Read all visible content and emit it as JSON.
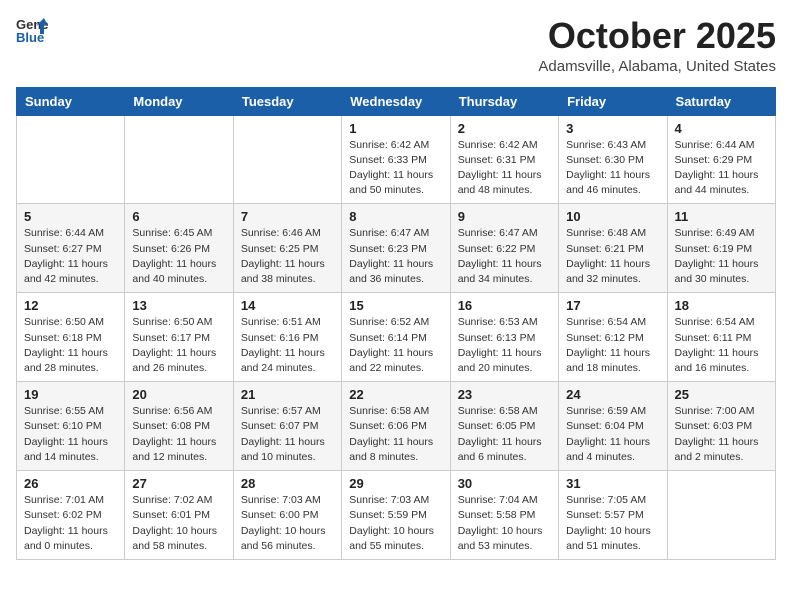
{
  "header": {
    "logo_general": "General",
    "logo_blue": "Blue",
    "month_title": "October 2025",
    "location": "Adamsville, Alabama, United States"
  },
  "days_of_week": [
    "Sunday",
    "Monday",
    "Tuesday",
    "Wednesday",
    "Thursday",
    "Friday",
    "Saturday"
  ],
  "weeks": [
    [
      {
        "day": "",
        "info": ""
      },
      {
        "day": "",
        "info": ""
      },
      {
        "day": "",
        "info": ""
      },
      {
        "day": "1",
        "info": "Sunrise: 6:42 AM\nSunset: 6:33 PM\nDaylight: 11 hours\nand 50 minutes."
      },
      {
        "day": "2",
        "info": "Sunrise: 6:42 AM\nSunset: 6:31 PM\nDaylight: 11 hours\nand 48 minutes."
      },
      {
        "day": "3",
        "info": "Sunrise: 6:43 AM\nSunset: 6:30 PM\nDaylight: 11 hours\nand 46 minutes."
      },
      {
        "day": "4",
        "info": "Sunrise: 6:44 AM\nSunset: 6:29 PM\nDaylight: 11 hours\nand 44 minutes."
      }
    ],
    [
      {
        "day": "5",
        "info": "Sunrise: 6:44 AM\nSunset: 6:27 PM\nDaylight: 11 hours\nand 42 minutes."
      },
      {
        "day": "6",
        "info": "Sunrise: 6:45 AM\nSunset: 6:26 PM\nDaylight: 11 hours\nand 40 minutes."
      },
      {
        "day": "7",
        "info": "Sunrise: 6:46 AM\nSunset: 6:25 PM\nDaylight: 11 hours\nand 38 minutes."
      },
      {
        "day": "8",
        "info": "Sunrise: 6:47 AM\nSunset: 6:23 PM\nDaylight: 11 hours\nand 36 minutes."
      },
      {
        "day": "9",
        "info": "Sunrise: 6:47 AM\nSunset: 6:22 PM\nDaylight: 11 hours\nand 34 minutes."
      },
      {
        "day": "10",
        "info": "Sunrise: 6:48 AM\nSunset: 6:21 PM\nDaylight: 11 hours\nand 32 minutes."
      },
      {
        "day": "11",
        "info": "Sunrise: 6:49 AM\nSunset: 6:19 PM\nDaylight: 11 hours\nand 30 minutes."
      }
    ],
    [
      {
        "day": "12",
        "info": "Sunrise: 6:50 AM\nSunset: 6:18 PM\nDaylight: 11 hours\nand 28 minutes."
      },
      {
        "day": "13",
        "info": "Sunrise: 6:50 AM\nSunset: 6:17 PM\nDaylight: 11 hours\nand 26 minutes."
      },
      {
        "day": "14",
        "info": "Sunrise: 6:51 AM\nSunset: 6:16 PM\nDaylight: 11 hours\nand 24 minutes."
      },
      {
        "day": "15",
        "info": "Sunrise: 6:52 AM\nSunset: 6:14 PM\nDaylight: 11 hours\nand 22 minutes."
      },
      {
        "day": "16",
        "info": "Sunrise: 6:53 AM\nSunset: 6:13 PM\nDaylight: 11 hours\nand 20 minutes."
      },
      {
        "day": "17",
        "info": "Sunrise: 6:54 AM\nSunset: 6:12 PM\nDaylight: 11 hours\nand 18 minutes."
      },
      {
        "day": "18",
        "info": "Sunrise: 6:54 AM\nSunset: 6:11 PM\nDaylight: 11 hours\nand 16 minutes."
      }
    ],
    [
      {
        "day": "19",
        "info": "Sunrise: 6:55 AM\nSunset: 6:10 PM\nDaylight: 11 hours\nand 14 minutes."
      },
      {
        "day": "20",
        "info": "Sunrise: 6:56 AM\nSunset: 6:08 PM\nDaylight: 11 hours\nand 12 minutes."
      },
      {
        "day": "21",
        "info": "Sunrise: 6:57 AM\nSunset: 6:07 PM\nDaylight: 11 hours\nand 10 minutes."
      },
      {
        "day": "22",
        "info": "Sunrise: 6:58 AM\nSunset: 6:06 PM\nDaylight: 11 hours\nand 8 minutes."
      },
      {
        "day": "23",
        "info": "Sunrise: 6:58 AM\nSunset: 6:05 PM\nDaylight: 11 hours\nand 6 minutes."
      },
      {
        "day": "24",
        "info": "Sunrise: 6:59 AM\nSunset: 6:04 PM\nDaylight: 11 hours\nand 4 minutes."
      },
      {
        "day": "25",
        "info": "Sunrise: 7:00 AM\nSunset: 6:03 PM\nDaylight: 11 hours\nand 2 minutes."
      }
    ],
    [
      {
        "day": "26",
        "info": "Sunrise: 7:01 AM\nSunset: 6:02 PM\nDaylight: 11 hours\nand 0 minutes."
      },
      {
        "day": "27",
        "info": "Sunrise: 7:02 AM\nSunset: 6:01 PM\nDaylight: 10 hours\nand 58 minutes."
      },
      {
        "day": "28",
        "info": "Sunrise: 7:03 AM\nSunset: 6:00 PM\nDaylight: 10 hours\nand 56 minutes."
      },
      {
        "day": "29",
        "info": "Sunrise: 7:03 AM\nSunset: 5:59 PM\nDaylight: 10 hours\nand 55 minutes."
      },
      {
        "day": "30",
        "info": "Sunrise: 7:04 AM\nSunset: 5:58 PM\nDaylight: 10 hours\nand 53 minutes."
      },
      {
        "day": "31",
        "info": "Sunrise: 7:05 AM\nSunset: 5:57 PM\nDaylight: 10 hours\nand 51 minutes."
      },
      {
        "day": "",
        "info": ""
      }
    ]
  ]
}
